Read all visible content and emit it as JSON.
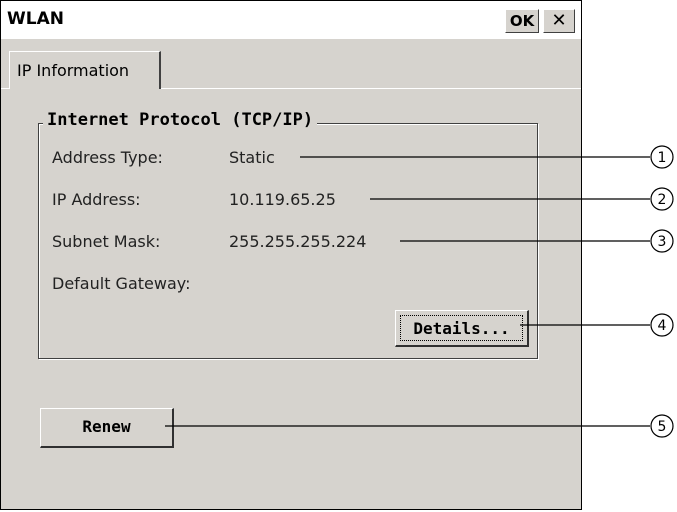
{
  "window": {
    "title": "WLAN",
    "ok_label": "OK",
    "close_label": "✕"
  },
  "tabs": [
    {
      "label": "IP Information",
      "selected": true
    }
  ],
  "group": {
    "title": "Internet Protocol (TCP/IP)",
    "rows": [
      {
        "label": "Address Type:",
        "value": "Static"
      },
      {
        "label": "IP Address:",
        "value": "10.119.65.25"
      },
      {
        "label": "Subnet Mask:",
        "value": "255.255.255.224"
      },
      {
        "label": "Default Gateway:",
        "value": ""
      }
    ],
    "details_label": "Details..."
  },
  "renew_label": "Renew",
  "callouts": [
    "1",
    "2",
    "3",
    "4",
    "5"
  ]
}
